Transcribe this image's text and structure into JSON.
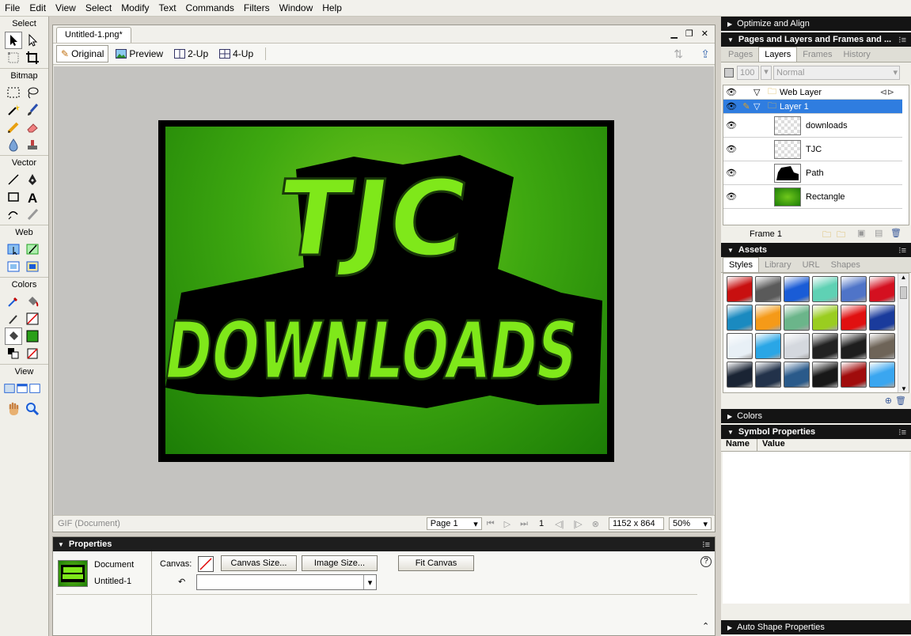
{
  "menu": [
    "File",
    "Edit",
    "View",
    "Select",
    "Modify",
    "Text",
    "Commands",
    "Filters",
    "Window",
    "Help"
  ],
  "tools": {
    "select_label": "Select",
    "bitmap_label": "Bitmap",
    "vector_label": "Vector",
    "web_label": "Web",
    "colors_label": "Colors",
    "view_label": "View"
  },
  "document": {
    "tab_title": "Untitled-1.png*",
    "views": [
      "Original",
      "Preview",
      "2-Up",
      "4-Up"
    ],
    "status_format": "GIF (Document)",
    "page": "Page 1",
    "frame": "1",
    "size": "1152 x 864",
    "zoom": "50%"
  },
  "artwork_text": {
    "line1": "TJC",
    "line2": "DOWNLOADS"
  },
  "properties": {
    "title": "Properties",
    "doc_type": "Document",
    "doc_name": "Untitled-1",
    "canvas_label": "Canvas:",
    "canvas_size_btn": "Canvas Size...",
    "image_size_btn": "Image Size...",
    "fit_canvas_btn": "Fit Canvas",
    "help_glyph": "?"
  },
  "panels": {
    "optimize": "Optimize and Align",
    "pages_layers": "Pages and Layers and Frames and ...",
    "pl_tabs": [
      "Pages",
      "Layers",
      "Frames",
      "History"
    ],
    "opacity": "100",
    "blend": "Normal",
    "layers": [
      {
        "name": "Web Layer",
        "kind": "folder"
      },
      {
        "name": "Layer 1",
        "kind": "folder",
        "selected": true
      },
      {
        "name": "downloads",
        "kind": "item"
      },
      {
        "name": "TJC",
        "kind": "item"
      },
      {
        "name": "Path",
        "kind": "item"
      },
      {
        "name": "Rectangle",
        "kind": "item"
      }
    ],
    "frame_label": "Frame 1",
    "assets": "Assets",
    "asset_tabs": [
      "Styles",
      "Library",
      "URL",
      "Shapes"
    ],
    "colors": "Colors",
    "symbol_props": "Symbol Properties",
    "sym_cols": [
      "Name",
      "Value"
    ],
    "auto_shape": "Auto Shape Properties"
  },
  "swatch_colors": [
    "#c81010",
    "#5a5a5a",
    "#1a5cd6",
    "#5fd1b4",
    "#4f74c8",
    "#d41020",
    "#1a8ac0",
    "#f59a18",
    "#6bb58a",
    "#9acd20",
    "#e01010",
    "#1a3b9c",
    "#e8f0f6",
    "#2aa6e6",
    "#d4d8de",
    "#222222",
    "#1e1e1e",
    "#6e6458",
    "#1a2434",
    "#22324a",
    "#2a5a8a",
    "#181818",
    "#a00c0c",
    "#3aa6f0"
  ]
}
